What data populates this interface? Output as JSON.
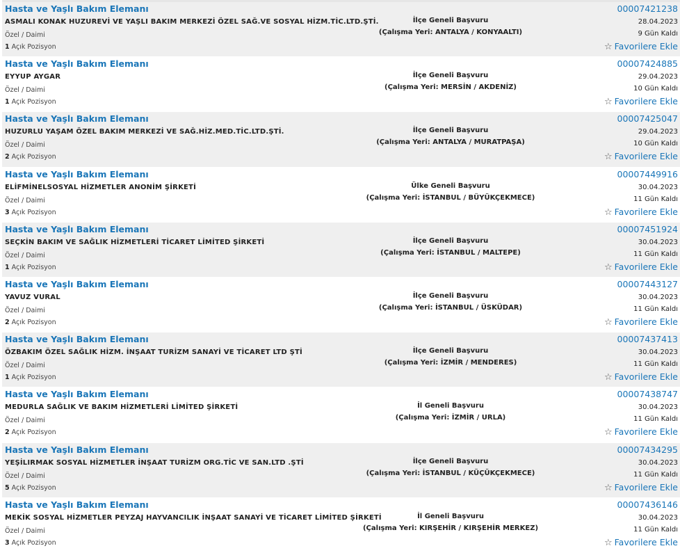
{
  "favorite_label": "Favorilere Ekle",
  "colors": {
    "link": "#1a76b8",
    "row_alt_bg": "#efefef",
    "row_bg": "#ffffff"
  },
  "icons": {
    "favorite": "star-outline-icon"
  },
  "jobs": [
    {
      "title": "Hasta ve Yaşlı Bakım Elemanı",
      "company": "ASMALI KONAK HUZUREVİ VE YAŞLI BAKIM MERKEZİ ÖZEL SAĞ.VE SOSYAL HİZM.TİC.LTD.ŞTİ.",
      "type": "Özel / Daimi",
      "open_count": "1",
      "open_label": "Açık Pozisyon",
      "apply_scope": "İlçe Geneli Başvuru",
      "location": "(Çalışma Yeri: ANTALYA / KONYAALTI)",
      "ilan_no": "00007421238",
      "date": "28.04.2023",
      "remaining": "9 Gün Kaldı"
    },
    {
      "title": "Hasta ve Yaşlı Bakım Elemanı",
      "company": "EYYUP AYGAR",
      "type": "Özel / Daimi",
      "open_count": "1",
      "open_label": "Açık Pozisyon",
      "apply_scope": "İlçe Geneli Başvuru",
      "location": "(Çalışma Yeri: MERSİN / AKDENİZ)",
      "ilan_no": "00007424885",
      "date": "29.04.2023",
      "remaining": "10 Gün Kaldı"
    },
    {
      "title": "Hasta ve Yaşlı Bakım Elemanı",
      "company": "HUZURLU YAŞAM ÖZEL BAKIM MERKEZİ VE SAĞ.HİZ.MED.TİC.LTD.ŞTİ.",
      "type": "Özel / Daimi",
      "open_count": "2",
      "open_label": "Açık Pozisyon",
      "apply_scope": "İlçe Geneli Başvuru",
      "location": "(Çalışma Yeri: ANTALYA / MURATPAŞA)",
      "ilan_no": "00007425047",
      "date": "29.04.2023",
      "remaining": "10 Gün Kaldı"
    },
    {
      "title": "Hasta ve Yaşlı Bakım Elemanı",
      "company": "ELİFMİNELSOSYAL HİZMETLER ANONİM ŞİRKETİ",
      "type": "Özel / Daimi",
      "open_count": "3",
      "open_label": "Açık Pozisyon",
      "apply_scope": "Ülke Geneli Başvuru",
      "location": "(Çalışma Yeri: İSTANBUL / BÜYÜKÇEKMECE)",
      "ilan_no": "00007449916",
      "date": "30.04.2023",
      "remaining": "11 Gün Kaldı"
    },
    {
      "title": "Hasta ve Yaşlı Bakım Elemanı",
      "company": "SEÇKİN BAKIM VE SAĞLIK HİZMETLERİ TİCARET LİMİTED ŞİRKETİ",
      "type": "Özel / Daimi",
      "open_count": "1",
      "open_label": "Açık Pozisyon",
      "apply_scope": "İlçe Geneli Başvuru",
      "location": "(Çalışma Yeri: İSTANBUL / MALTEPE)",
      "ilan_no": "00007451924",
      "date": "30.04.2023",
      "remaining": "11 Gün Kaldı"
    },
    {
      "title": "Hasta ve Yaşlı Bakım Elemanı",
      "company": "YAVUZ VURAL",
      "type": "Özel / Daimi",
      "open_count": "2",
      "open_label": "Açık Pozisyon",
      "apply_scope": "İlçe Geneli Başvuru",
      "location": "(Çalışma Yeri: İSTANBUL / ÜSKÜDAR)",
      "ilan_no": "00007443127",
      "date": "30.04.2023",
      "remaining": "11 Gün Kaldı"
    },
    {
      "title": "Hasta ve Yaşlı Bakım Elemanı",
      "company": "ÖZBAKIM ÖZEL SAĞLIK HİZM. İNŞAAT TURİZM SANAYİ VE TİCARET LTD ŞTİ",
      "type": "Özel / Daimi",
      "open_count": "1",
      "open_label": "Açık Pozisyon",
      "apply_scope": "İlçe Geneli Başvuru",
      "location": "(Çalışma Yeri: İZMİR / MENDERES)",
      "ilan_no": "00007437413",
      "date": "30.04.2023",
      "remaining": "11 Gün Kaldı"
    },
    {
      "title": "Hasta ve Yaşlı Bakım Elemanı",
      "company": "MEDURLA SAĞLIK VE BAKIM HİZMETLERİ LİMİTED ŞİRKETİ",
      "type": "Özel / Daimi",
      "open_count": "2",
      "open_label": "Açık Pozisyon",
      "apply_scope": "İl Geneli Başvuru",
      "location": "(Çalışma Yeri: İZMİR / URLA)",
      "ilan_no": "00007438747",
      "date": "30.04.2023",
      "remaining": "11 Gün Kaldı"
    },
    {
      "title": "Hasta ve Yaşlı Bakım Elemanı",
      "company": "YEŞİLIRMAK SOSYAL HİZMETLER İNŞAAT TURİZM ORG.TİC VE SAN.LTD .ŞTİ",
      "type": "Özel / Daimi",
      "open_count": "5",
      "open_label": "Açık Pozisyon",
      "apply_scope": "İlçe Geneli Başvuru",
      "location": "(Çalışma Yeri: İSTANBUL / KÜÇÜKÇEKMECE)",
      "ilan_no": "00007434295",
      "date": "30.04.2023",
      "remaining": "11 Gün Kaldı"
    },
    {
      "title": "Hasta ve Yaşlı Bakım Elemanı",
      "company": "MEKİK SOSYAL HİZMETLER PEYZAJ HAYVANCILIK İNŞAAT SANAYİ VE TİCARET LİMİTED ŞİRKETİ",
      "type": "Özel / Daimi",
      "open_count": "3",
      "open_label": "Açık Pozisyon",
      "apply_scope": "İl Geneli Başvuru",
      "location": "(Çalışma Yeri: KIRŞEHİR / KIRŞEHİR MERKEZ)",
      "ilan_no": "00007436146",
      "date": "30.04.2023",
      "remaining": "11 Gün Kaldı"
    }
  ]
}
